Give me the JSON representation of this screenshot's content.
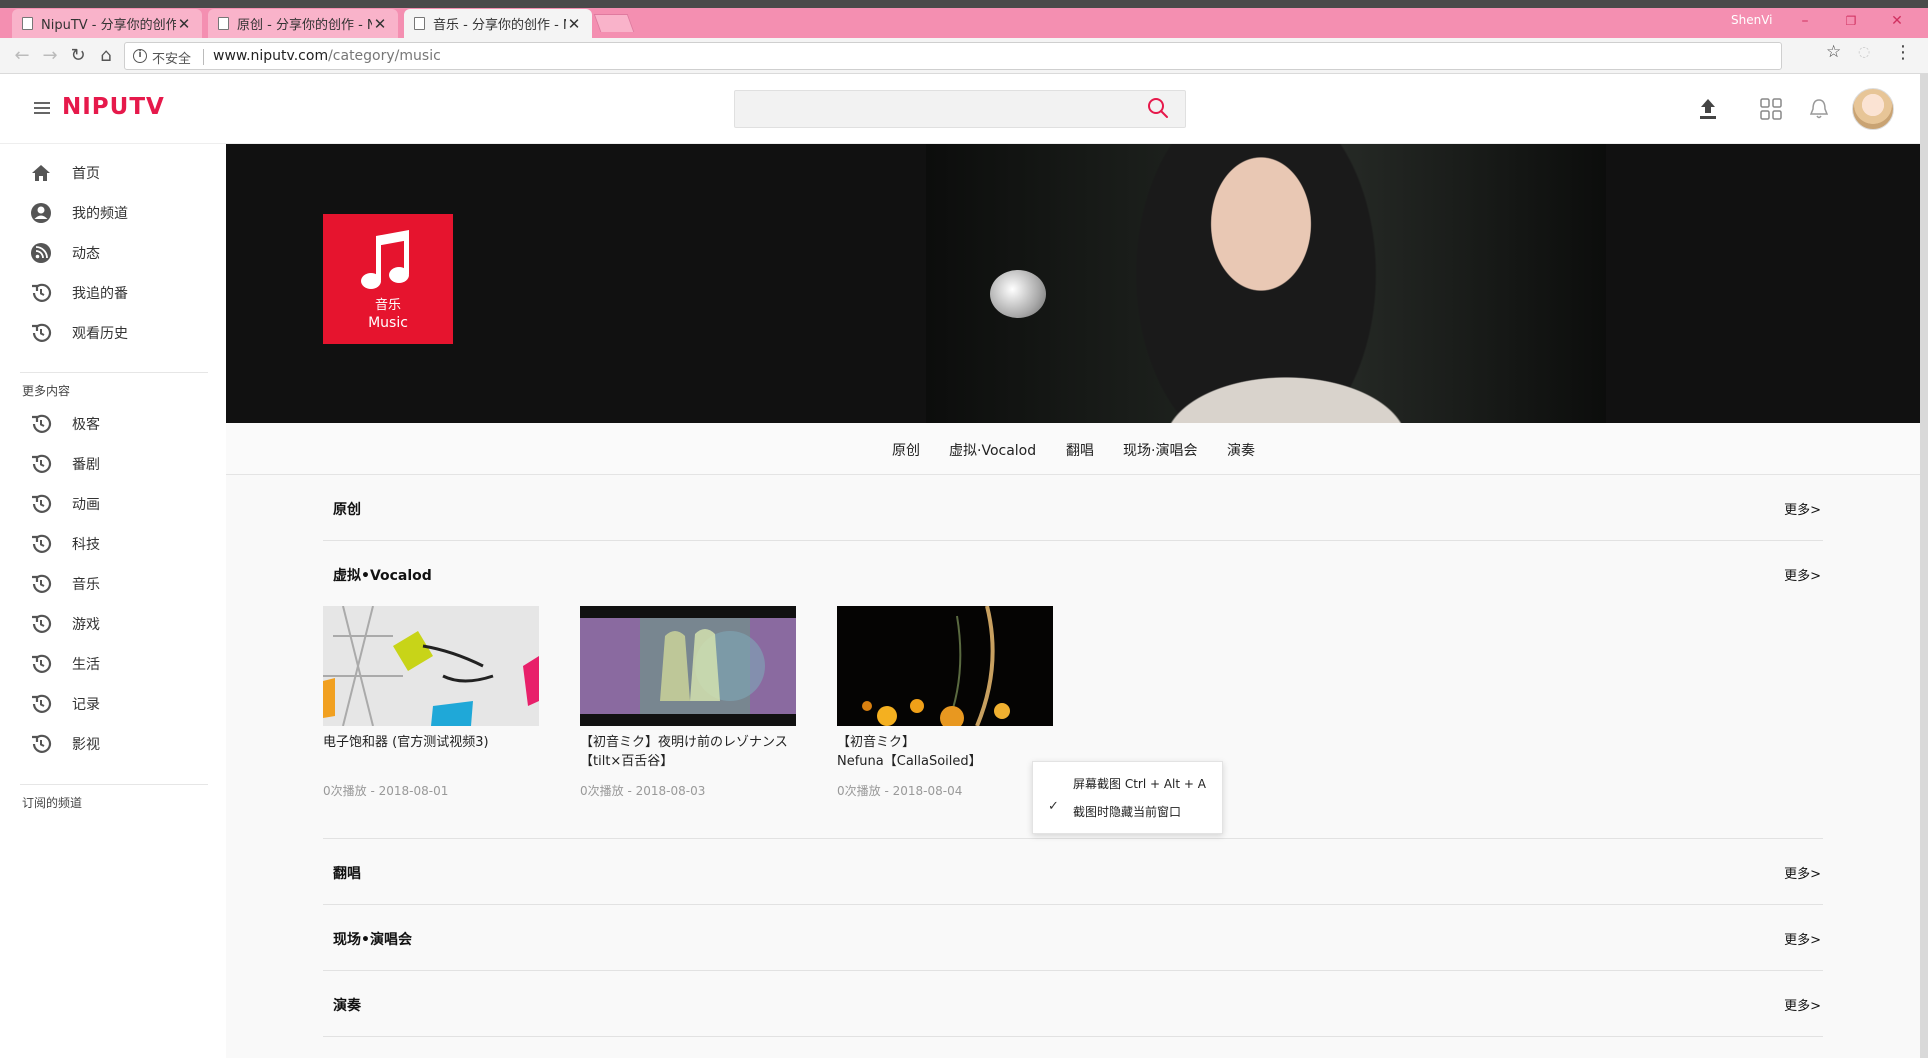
{
  "browser": {
    "tabs": [
      {
        "label": "NipuTV - 分享你的创作"
      },
      {
        "label": "原创 - 分享你的创作 - Ni"
      },
      {
        "label": "音乐 - 分享你的创作 - Ni"
      }
    ],
    "user_name": "ShenVi",
    "window_controls": {
      "minimize": "–",
      "restore": "❐",
      "close": "✕"
    },
    "security_label": "不安全",
    "url_host": "www.niputv.com",
    "url_path": "/category/music"
  },
  "site": {
    "logo": "NIPUTV",
    "search": {
      "placeholder": ""
    }
  },
  "sidebar": {
    "items": [
      {
        "label": "首页",
        "icon": "home-icon"
      },
      {
        "label": "我的频道",
        "icon": "user-icon"
      },
      {
        "label": "动态",
        "icon": "rss-icon"
      },
      {
        "label": "我追的番",
        "icon": "history-icon"
      },
      {
        "label": "观看历史",
        "icon": "history-icon"
      }
    ],
    "more_heading": "更多内容",
    "more_items": [
      {
        "label": "极客",
        "icon": "history-icon"
      },
      {
        "label": "番剧",
        "icon": "history-icon"
      },
      {
        "label": "动画",
        "icon": "history-icon"
      },
      {
        "label": "科技",
        "icon": "history-icon"
      },
      {
        "label": "音乐",
        "icon": "history-icon"
      },
      {
        "label": "游戏",
        "icon": "history-icon"
      },
      {
        "label": "生活",
        "icon": "history-icon"
      },
      {
        "label": "记录",
        "icon": "history-icon"
      },
      {
        "label": "影视",
        "icon": "history-icon"
      }
    ],
    "subscribed_heading": "订阅的频道"
  },
  "category": {
    "name_cn": "音乐",
    "name_en": "Music",
    "badge_color": "#e6142e",
    "subnav": [
      "原创",
      "虚拟·Vocalod",
      "翻唱",
      "现场·演唱会",
      "演奏"
    ]
  },
  "sections": [
    {
      "title": "原创",
      "more": "更多>"
    },
    {
      "title": "虚拟•Vocalod",
      "more": "更多>"
    },
    {
      "title": "翻唱",
      "more": "更多>"
    },
    {
      "title": "现场•演唱会",
      "more": "更多>"
    },
    {
      "title": "演奏",
      "more": "更多>"
    }
  ],
  "videos": [
    {
      "title": "电子饱和器 (官方测试视频3)",
      "meta": "0次播放 - 2018-08-01"
    },
    {
      "title": "【初音ミク】夜明け前のレゾナンス【tilt×百舌谷】",
      "meta": "0次播放 - 2018-08-03"
    },
    {
      "title": "【初音ミク】\nNefuna【CallaSoiled】",
      "meta": "0次播放 - 2018-08-04"
    }
  ],
  "context_menu": {
    "items": [
      {
        "label": "屏幕截图 Ctrl + Alt + A",
        "checked": false
      },
      {
        "label": "截图时隐藏当前窗口",
        "checked": true
      }
    ]
  },
  "colors": {
    "brand": "#e6194b",
    "tabstrip": "#f48fb1"
  }
}
